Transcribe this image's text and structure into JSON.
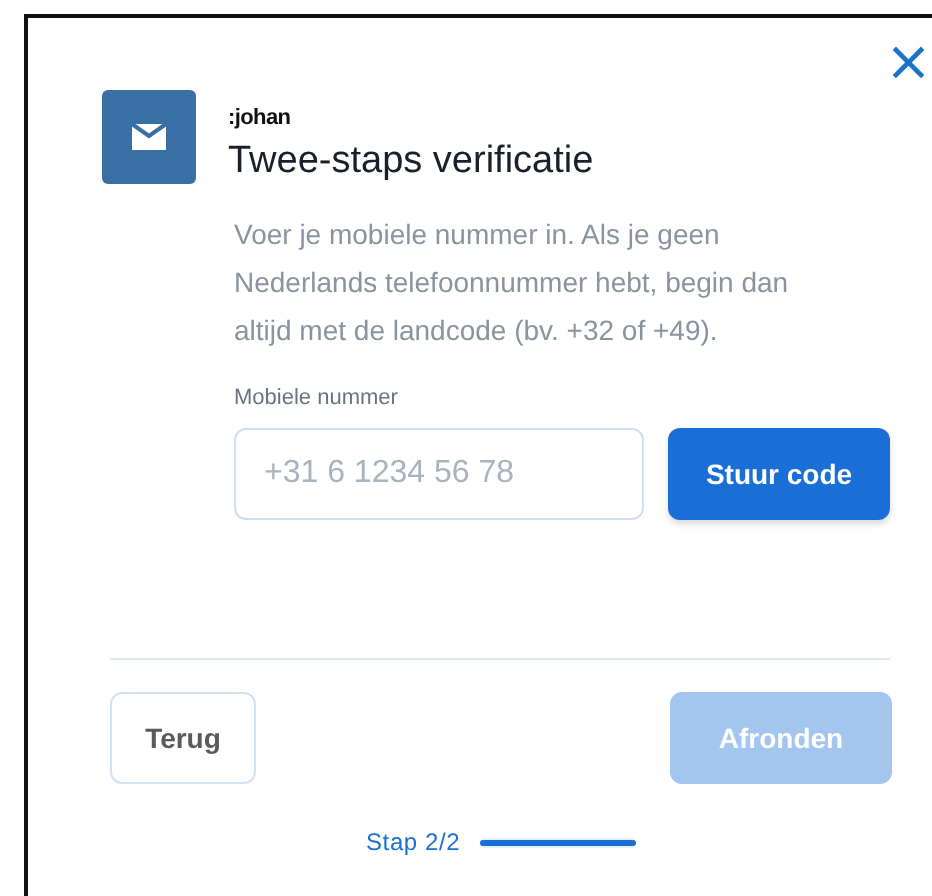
{
  "dialog": {
    "close": "×",
    "brand": ":johan",
    "title": "Twee-staps verificatie",
    "description": "Voer je mobiele nummer in. Als je geen Nederlands telefoonnummer hebt, begin dan altijd met de landcode (bv. +32 of +49).",
    "phone": {
      "label": "Mobiele nummer",
      "placeholder": "+31 6 1234 56 78"
    },
    "send_button": {
      "label": "Stuur code",
      "disabled": false
    },
    "back_button": {
      "label": "Terug",
      "disabled": false
    },
    "finish_button": {
      "label": "Afronden",
      "disabled": true
    },
    "progress": {
      "label": "Stap 2/2",
      "level": 1
    }
  }
}
